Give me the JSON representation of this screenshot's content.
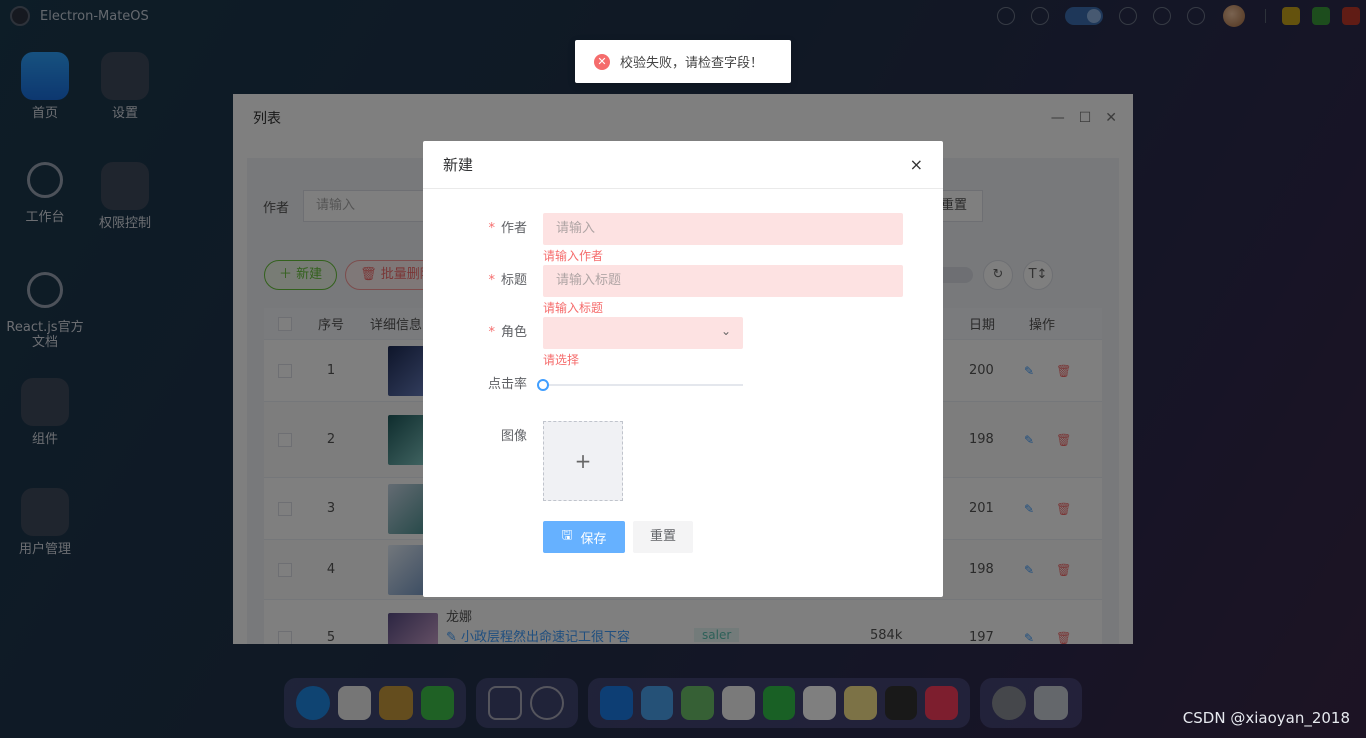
{
  "topbar": {
    "app_title": "Electron-MateOS"
  },
  "desktop": {
    "icons": [
      {
        "label": "首页",
        "icon": "app-store-icon"
      },
      {
        "label": "设置",
        "icon": "settings-widget-icon"
      },
      {
        "label": "工作台",
        "icon": "dashboard-icon"
      },
      {
        "label": "权限控制",
        "icon": "permission-widget-icon"
      },
      {
        "label": "React.js官方文档",
        "icon": "link-icon"
      },
      {
        "label": "组件",
        "icon": "components-icon"
      },
      {
        "label": "用户管理",
        "icon": "users-icon"
      }
    ]
  },
  "list_window": {
    "title": "列表",
    "search": {
      "author_label": "作者",
      "author_placeholder": "请输入",
      "reset_label": "重置"
    },
    "actions": {
      "new_label": "新建",
      "batch_delete_label": "批量删除"
    },
    "table": {
      "headers": {
        "index": "序号",
        "detail": "详细信息",
        "date": "日期",
        "ops": "操作"
      },
      "rows": [
        {
          "index": "1",
          "date": "200"
        },
        {
          "index": "2",
          "date": "198"
        },
        {
          "index": "3",
          "date": "201"
        },
        {
          "index": "4",
          "date": "198"
        },
        {
          "index": "5",
          "date": "197",
          "author": "龙娜",
          "title": "小政层程然出命速记工很下容",
          "tag": "saler",
          "views": "584k"
        }
      ]
    }
  },
  "message": {
    "type": "error",
    "text": "校验失败，请检查字段！"
  },
  "dialog": {
    "title": "新建",
    "close_symbol": "×",
    "fields": {
      "author": {
        "label": "作者",
        "placeholder": "请输入",
        "error": "请输入作者"
      },
      "title": {
        "label": "标题",
        "placeholder": "请输入标题",
        "error": "请输入标题"
      },
      "role": {
        "label": "角色",
        "value": "",
        "error": "请选择"
      },
      "click_rate": {
        "label": "点击率",
        "value": 0
      },
      "image": {
        "label": "图像",
        "upload_symbol": "+"
      }
    },
    "save_label": "保存",
    "reset_label": "重置",
    "colors": {
      "error": "#f56c6c",
      "primary": "#409eff"
    }
  },
  "watermark": "CSDN @xiaoyan_2018"
}
